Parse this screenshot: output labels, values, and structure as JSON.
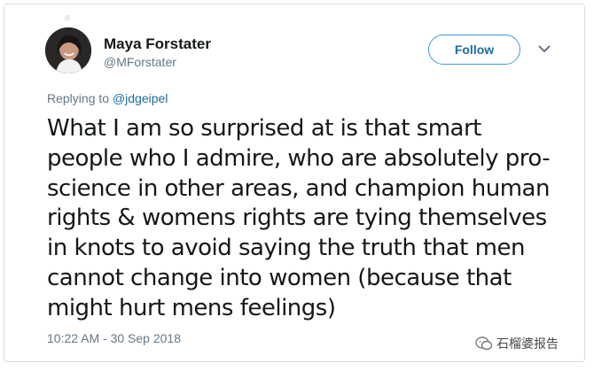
{
  "tweet": {
    "author_name": "Maya Forstater",
    "author_handle": "@MForstater",
    "follow_label": "Follow",
    "replying_prefix": "Replying to ",
    "replying_to": "@jdgeipel",
    "text": "What I am so surprised at is that smart\npeople who I admire, who are absolutely pro-\nscience in other areas, and champion human\nrights & womens rights are tying themselves\nin knots to avoid saying the truth that men\ncannot change into women (because that\nmight hurt mens feelings)",
    "timestamp": "10:22 AM - 30 Sep 2018"
  },
  "watermark": {
    "text": "石榴婆报告",
    "icon": "wechat-icon"
  },
  "icons": {
    "more": "chevron-down-icon",
    "avatar": "avatar"
  },
  "colors": {
    "accent": "#1b6d9c",
    "border": "#3d9ad6",
    "muted": "#657786",
    "text": "#14171a"
  }
}
